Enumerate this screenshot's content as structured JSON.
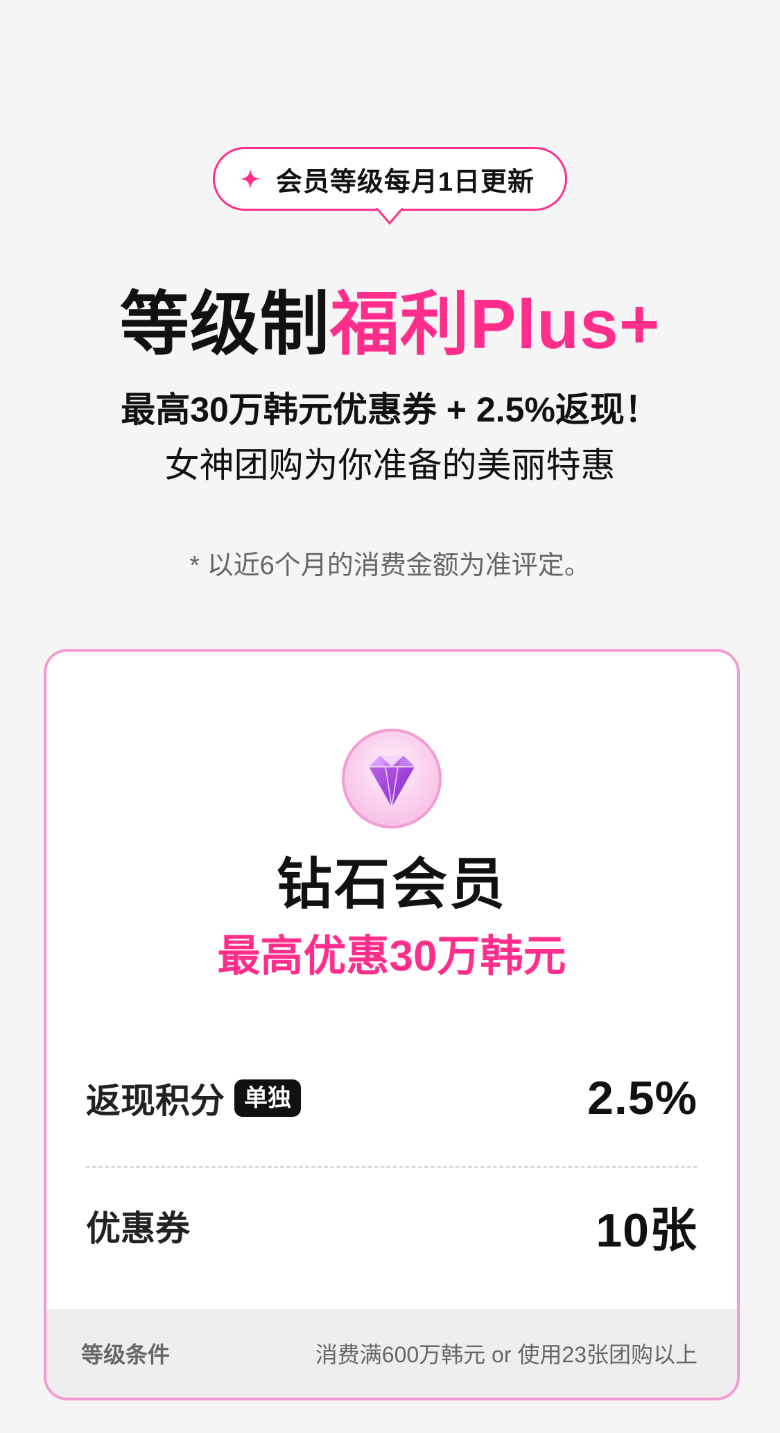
{
  "badge": {
    "text": "会员等级每月1日更新",
    "accent": "#ff2e8c"
  },
  "headline": {
    "part1": "等级制",
    "part2": "福利Plus+"
  },
  "subtitle": {
    "line1": "最高30万韩元优惠券 + 2.5%返现！",
    "line2": "女神团购为你准备的美丽特惠"
  },
  "footnote": "* 以近6个月的消费金额为准评定。",
  "card": {
    "icon": "diamond-icon",
    "tier_name": "钻石会员",
    "tier_benefit": "最高优惠30万韩元",
    "rows": [
      {
        "label": "返现积分",
        "tag": "单独",
        "value": "2.5%"
      },
      {
        "label": "优惠券",
        "value": "10张"
      }
    ],
    "condition": {
      "label": "等级条件",
      "value": "消费满600万韩元 or 使用23张团购以上"
    },
    "border_color": "#f59bd3"
  }
}
